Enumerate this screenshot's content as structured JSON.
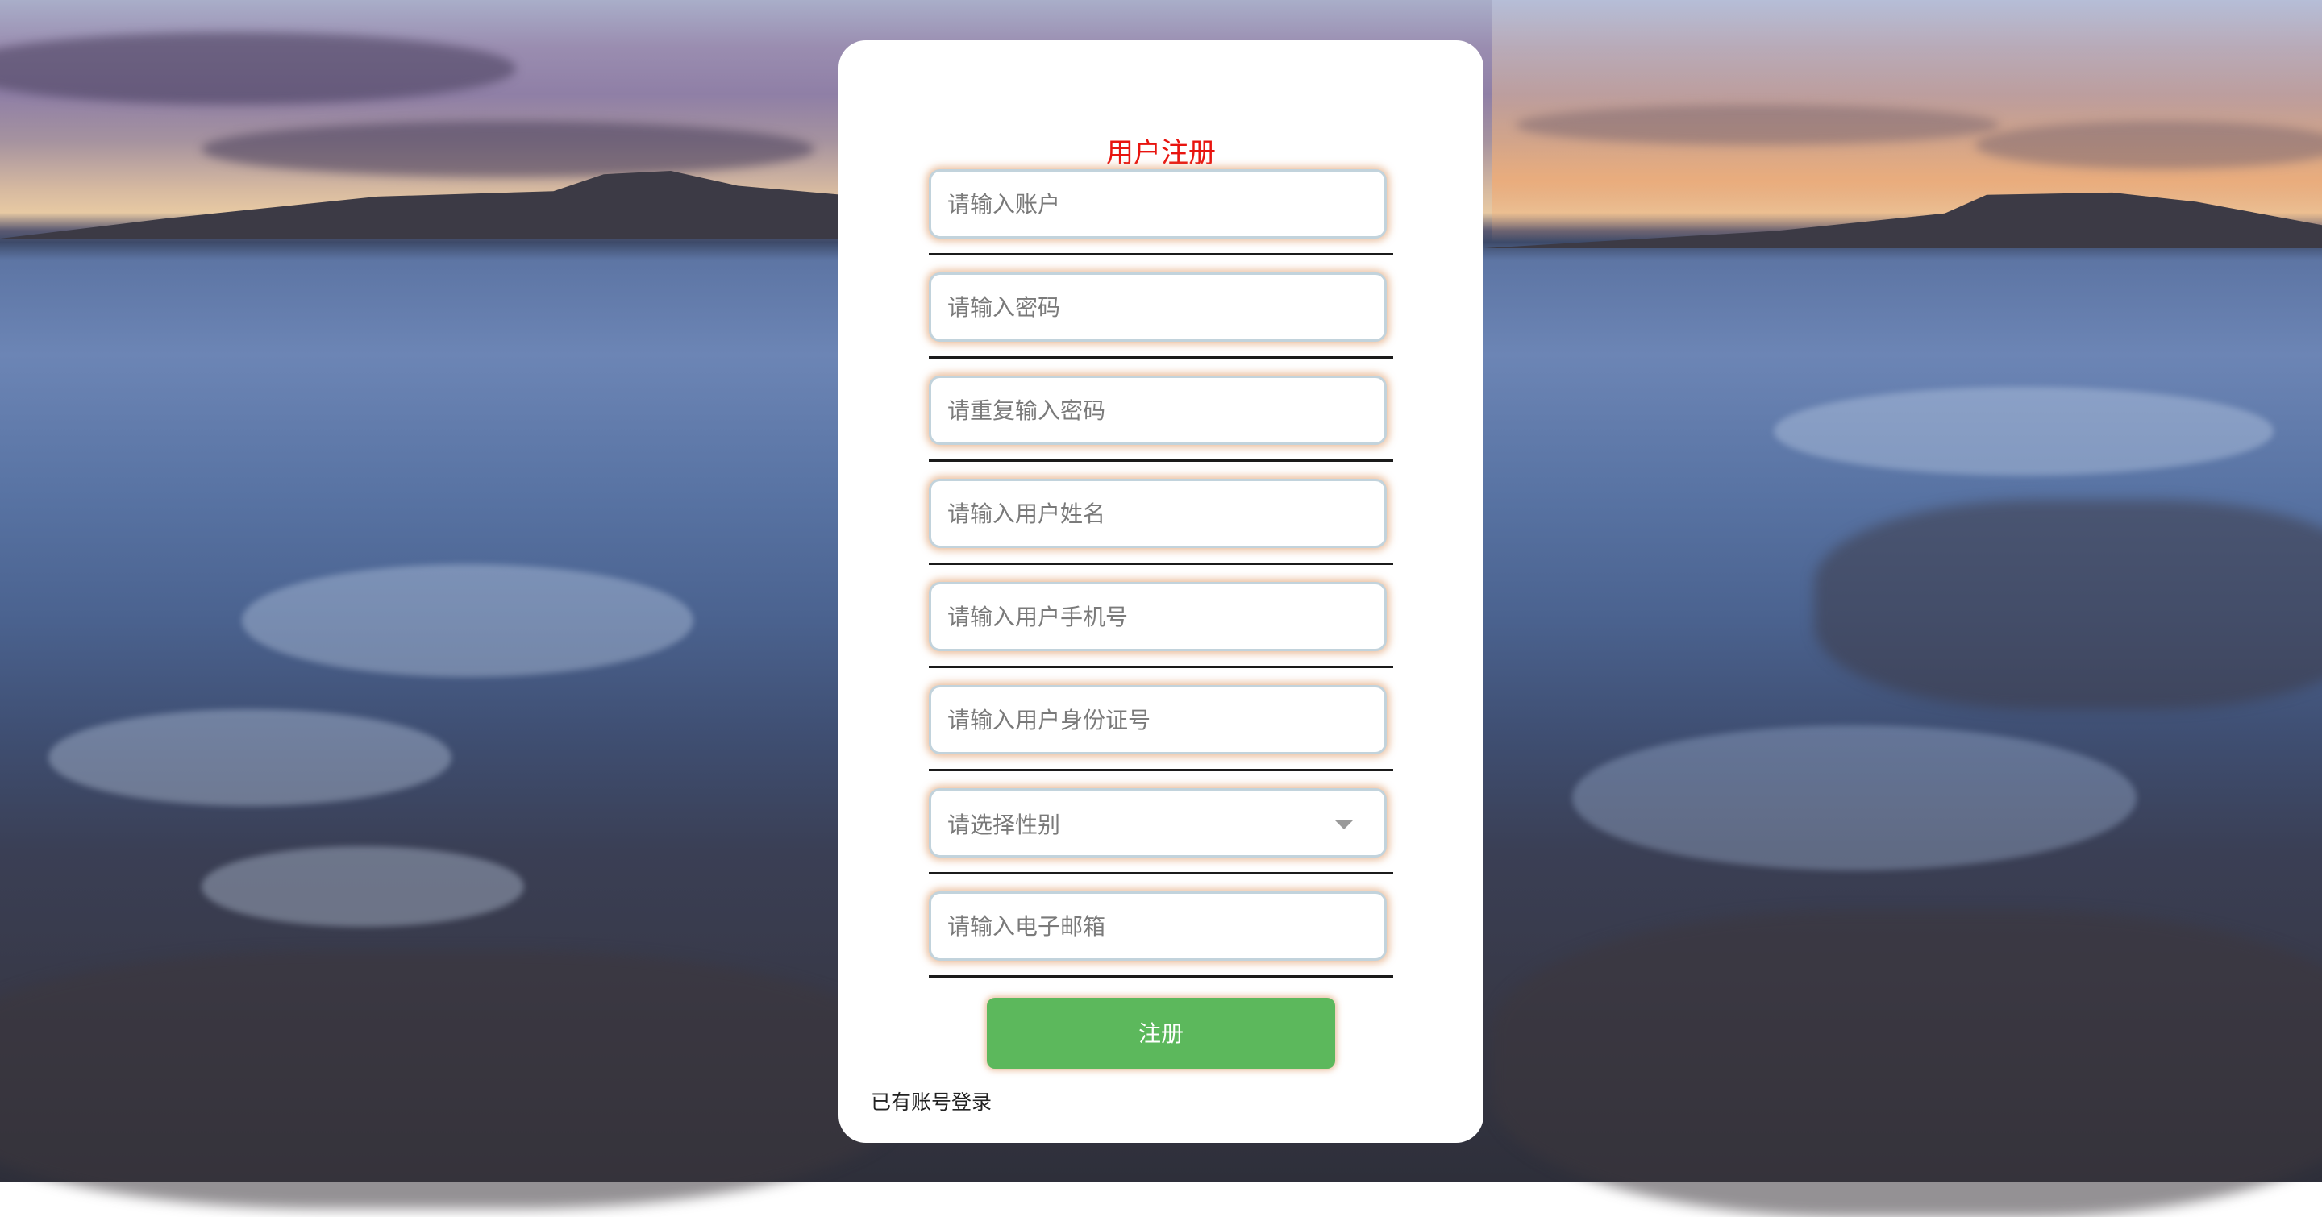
{
  "form": {
    "title": "用户注册",
    "fields": [
      {
        "placeholder": "请输入账户",
        "value": ""
      },
      {
        "placeholder": "请输入密码",
        "value": ""
      },
      {
        "placeholder": "请重复输入密码",
        "value": ""
      },
      {
        "placeholder": "请输入用户姓名",
        "value": ""
      },
      {
        "placeholder": "请输入用户手机号",
        "value": ""
      },
      {
        "placeholder": "请输入用户身份证号",
        "value": ""
      }
    ],
    "gender_select": {
      "selected_text": "请选择性别"
    },
    "email_field": {
      "placeholder": "请输入电子邮箱",
      "value": ""
    },
    "submit_label": "注册",
    "login_link": "已有账号登录"
  },
  "colors": {
    "title": "#e8140f",
    "submit_bg": "#5cb85c",
    "card_bg": "#ffffff"
  }
}
